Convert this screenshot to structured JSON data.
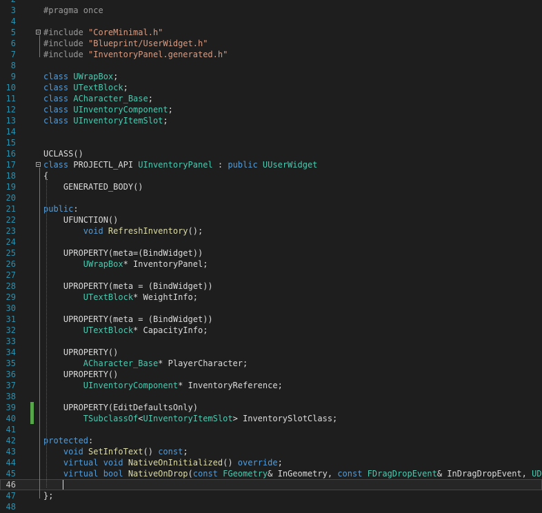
{
  "editor": {
    "colors": {
      "background": "#1e1e1e",
      "line_number": "#2b91af",
      "keyword": "#569cd6",
      "type": "#4ec9b0",
      "string": "#d69d85",
      "preprocessor": "#9b9b9b",
      "macro": "#bd63c5",
      "function": "#dcdcaa",
      "plain": "#dcdcdc",
      "change_marker": "#57a64a"
    },
    "current_line": "46",
    "lines": [
      {
        "n": "2",
        "tokens": []
      },
      {
        "n": "3",
        "tokens": [
          {
            "t": "#pragma once",
            "c": "pre"
          }
        ]
      },
      {
        "n": "4",
        "tokens": []
      },
      {
        "n": "5",
        "fold": true,
        "tokens": [
          {
            "t": "#include ",
            "c": "pre"
          },
          {
            "t": "\"CoreMinimal.h\"",
            "c": "str"
          }
        ]
      },
      {
        "n": "6",
        "tokens": [
          {
            "t": "#include ",
            "c": "pre"
          },
          {
            "t": "\"Blueprint/UserWidget.h\"",
            "c": "str"
          }
        ]
      },
      {
        "n": "7",
        "tokens": [
          {
            "t": "#include ",
            "c": "pre"
          },
          {
            "t": "\"InventoryPanel.generated.h\"",
            "c": "str"
          }
        ]
      },
      {
        "n": "8",
        "tokens": []
      },
      {
        "n": "9",
        "tokens": [
          {
            "t": "class ",
            "c": "kw"
          },
          {
            "t": "UWrapBox",
            "c": "type"
          },
          {
            "t": ";",
            "c": "plain"
          }
        ]
      },
      {
        "n": "10",
        "tokens": [
          {
            "t": "class ",
            "c": "kw"
          },
          {
            "t": "UTextBlock",
            "c": "type"
          },
          {
            "t": ";",
            "c": "plain"
          }
        ]
      },
      {
        "n": "11",
        "tokens": [
          {
            "t": "class ",
            "c": "kw"
          },
          {
            "t": "ACharacter_Base",
            "c": "type"
          },
          {
            "t": ";",
            "c": "plain"
          }
        ]
      },
      {
        "n": "12",
        "tokens": [
          {
            "t": "class ",
            "c": "kw"
          },
          {
            "t": "UInventoryComponent",
            "c": "type"
          },
          {
            "t": ";",
            "c": "plain"
          }
        ]
      },
      {
        "n": "13",
        "tokens": [
          {
            "t": "class ",
            "c": "kw"
          },
          {
            "t": "UInventoryItemSlot",
            "c": "type"
          },
          {
            "t": ";",
            "c": "plain"
          }
        ]
      },
      {
        "n": "14",
        "tokens": []
      },
      {
        "n": "15",
        "tokens": []
      },
      {
        "n": "16",
        "tokens": [
          {
            "t": "UCLASS",
            "c": "plain"
          },
          {
            "t": "()",
            "c": "plain"
          }
        ]
      },
      {
        "n": "17",
        "fold": true,
        "tokens": [
          {
            "t": "class ",
            "c": "kw"
          },
          {
            "t": "PROJECTL_API ",
            "c": "plain"
          },
          {
            "t": "UInventoryPanel",
            "c": "type"
          },
          {
            "t": " : ",
            "c": "plain"
          },
          {
            "t": "public ",
            "c": "kw"
          },
          {
            "t": "UUserWidget",
            "c": "type"
          }
        ]
      },
      {
        "n": "18",
        "tokens": [
          {
            "t": "{",
            "c": "plain"
          }
        ]
      },
      {
        "n": "19",
        "tokens": [
          {
            "t": "    ",
            "c": "plain"
          },
          {
            "t": "GENERATED_BODY",
            "c": "plain"
          },
          {
            "t": "()",
            "c": "plain"
          }
        ]
      },
      {
        "n": "20",
        "tokens": []
      },
      {
        "n": "21",
        "tokens": [
          {
            "t": "public",
            "c": "kw"
          },
          {
            "t": ":",
            "c": "plain"
          }
        ]
      },
      {
        "n": "22",
        "tokens": [
          {
            "t": "    UFUNCTION",
            "c": "plain"
          },
          {
            "t": "()",
            "c": "plain"
          }
        ]
      },
      {
        "n": "23",
        "tokens": [
          {
            "t": "        ",
            "c": "plain"
          },
          {
            "t": "void ",
            "c": "kw"
          },
          {
            "t": "RefreshInventory",
            "c": "fn"
          },
          {
            "t": "();",
            "c": "plain"
          }
        ]
      },
      {
        "n": "24",
        "tokens": []
      },
      {
        "n": "25",
        "tokens": [
          {
            "t": "    UPROPERTY",
            "c": "plain"
          },
          {
            "t": "(meta=(BindWidget))",
            "c": "plain"
          }
        ]
      },
      {
        "n": "26",
        "tokens": [
          {
            "t": "        ",
            "c": "plain"
          },
          {
            "t": "UWrapBox",
            "c": "type"
          },
          {
            "t": "* InventoryPanel;",
            "c": "plain"
          }
        ]
      },
      {
        "n": "27",
        "tokens": []
      },
      {
        "n": "28",
        "tokens": [
          {
            "t": "    UPROPERTY",
            "c": "plain"
          },
          {
            "t": "(meta = (BindWidget))",
            "c": "plain"
          }
        ]
      },
      {
        "n": "29",
        "tokens": [
          {
            "t": "        ",
            "c": "plain"
          },
          {
            "t": "UTextBlock",
            "c": "type"
          },
          {
            "t": "* WeightInfo;",
            "c": "plain"
          }
        ]
      },
      {
        "n": "30",
        "tokens": []
      },
      {
        "n": "31",
        "tokens": [
          {
            "t": "    UPROPERTY",
            "c": "plain"
          },
          {
            "t": "(meta = (BindWidget))",
            "c": "plain"
          }
        ]
      },
      {
        "n": "32",
        "tokens": [
          {
            "t": "        ",
            "c": "plain"
          },
          {
            "t": "UTextBlock",
            "c": "type"
          },
          {
            "t": "* CapacityInfo;",
            "c": "plain"
          }
        ]
      },
      {
        "n": "33",
        "tokens": []
      },
      {
        "n": "34",
        "tokens": [
          {
            "t": "    UPROPERTY",
            "c": "plain"
          },
          {
            "t": "()",
            "c": "plain"
          }
        ]
      },
      {
        "n": "35",
        "tokens": [
          {
            "t": "        ",
            "c": "plain"
          },
          {
            "t": "ACharacter_Base",
            "c": "type"
          },
          {
            "t": "* PlayerCharacter;",
            "c": "plain"
          }
        ]
      },
      {
        "n": "36",
        "tokens": [
          {
            "t": "    UPROPERTY",
            "c": "plain"
          },
          {
            "t": "()",
            "c": "plain"
          }
        ]
      },
      {
        "n": "37",
        "tokens": [
          {
            "t": "        ",
            "c": "plain"
          },
          {
            "t": "UInventoryComponent",
            "c": "type"
          },
          {
            "t": "* InventoryReference;",
            "c": "plain"
          }
        ]
      },
      {
        "n": "38",
        "tokens": []
      },
      {
        "n": "39",
        "changed": true,
        "tokens": [
          {
            "t": "    UPROPERTY",
            "c": "plain"
          },
          {
            "t": "(EditDefaultsOnly)",
            "c": "plain"
          }
        ]
      },
      {
        "n": "40",
        "changed": true,
        "tokens": [
          {
            "t": "        ",
            "c": "plain"
          },
          {
            "t": "TSubclassOf",
            "c": "type"
          },
          {
            "t": "<",
            "c": "plain"
          },
          {
            "t": "UInventoryItemSlot",
            "c": "type"
          },
          {
            "t": "> InventorySlotClass;",
            "c": "plain"
          }
        ]
      },
      {
        "n": "41",
        "tokens": []
      },
      {
        "n": "42",
        "tokens": [
          {
            "t": "protected",
            "c": "kw"
          },
          {
            "t": ":",
            "c": "plain"
          }
        ]
      },
      {
        "n": "43",
        "tokens": [
          {
            "t": "    ",
            "c": "plain"
          },
          {
            "t": "void ",
            "c": "kw"
          },
          {
            "t": "SetInfoText",
            "c": "fn"
          },
          {
            "t": "() ",
            "c": "plain"
          },
          {
            "t": "const",
            "c": "kw"
          },
          {
            "t": ";",
            "c": "plain"
          }
        ]
      },
      {
        "n": "44",
        "tokens": [
          {
            "t": "    ",
            "c": "plain"
          },
          {
            "t": "virtual void ",
            "c": "kw"
          },
          {
            "t": "NativeOnInitialized",
            "c": "fn"
          },
          {
            "t": "() ",
            "c": "plain"
          },
          {
            "t": "override",
            "c": "kw"
          },
          {
            "t": ";",
            "c": "plain"
          }
        ]
      },
      {
        "n": "45",
        "tokens": [
          {
            "t": "    ",
            "c": "plain"
          },
          {
            "t": "virtual bool ",
            "c": "kw"
          },
          {
            "t": "NativeOnDrop",
            "c": "fn"
          },
          {
            "t": "(",
            "c": "plain"
          },
          {
            "t": "const ",
            "c": "kw"
          },
          {
            "t": "FGeometry",
            "c": "type"
          },
          {
            "t": "& InGeometry, ",
            "c": "plain"
          },
          {
            "t": "const ",
            "c": "kw"
          },
          {
            "t": "FDragDropEvent",
            "c": "type"
          },
          {
            "t": "& InDragDropEvent, ",
            "c": "plain"
          },
          {
            "t": "UDragDropOperation",
            "c": "type"
          }
        ]
      },
      {
        "n": "46",
        "current": true,
        "tokens": []
      },
      {
        "n": "47",
        "tokens": [
          {
            "t": "};",
            "c": "plain"
          }
        ]
      },
      {
        "n": "48",
        "tokens": []
      }
    ]
  }
}
